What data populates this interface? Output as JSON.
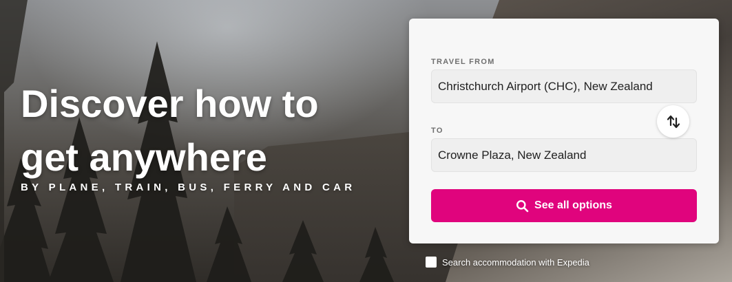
{
  "hero": {
    "headline_line1": "Discover how to",
    "headline_line2": "get anywhere",
    "subline": "BY PLANE, TRAIN, BUS, FERRY AND CAR"
  },
  "search_form": {
    "from_label": "TRAVEL FROM",
    "from_value": "Christchurch Airport (CHC), New Zealand",
    "to_label": "TO",
    "to_value": "Crowne Plaza, New Zealand",
    "swap_icon": "swap-vertical-icon",
    "submit_label": "See all options",
    "submit_icon": "search-icon",
    "accent_color": "#e0047d"
  },
  "accommodation": {
    "label": "Search accommodation with Expedia",
    "checked": false
  }
}
